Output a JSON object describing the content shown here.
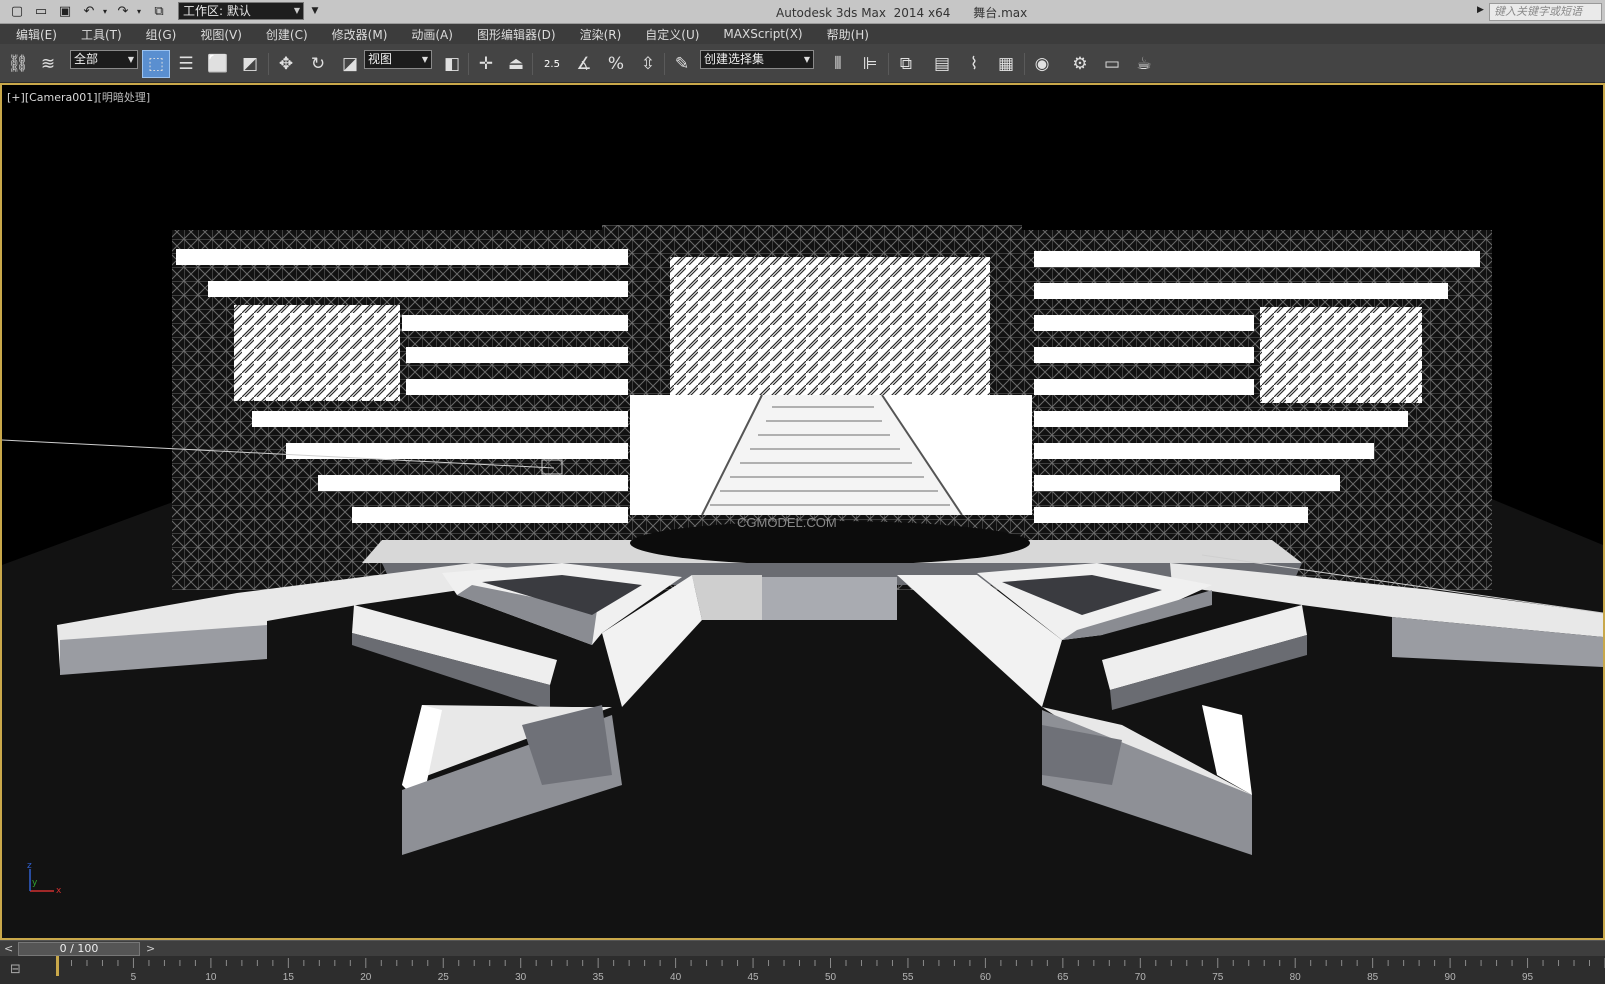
{
  "titlebar": {
    "app_title": "Autodesk 3ds Max  2014 x64",
    "file_name": "舞台.max",
    "workspace_label": "工作区: 默认",
    "search_placeholder": "键入关键字或短语",
    "quick_access": [
      "new-file-icon",
      "open-file-icon",
      "save-icon",
      "undo-icon",
      "redo-icon",
      "project-folder-icon"
    ]
  },
  "menubar": {
    "items": [
      "编辑(E)",
      "工具(T)",
      "组(G)",
      "视图(V)",
      "创建(C)",
      "修改器(M)",
      "动画(A)",
      "图形编辑器(D)",
      "渲染(R)",
      "自定义(U)",
      "MAXScript(X)",
      "帮助(H)"
    ]
  },
  "toolbar": {
    "selection_filter": "全部",
    "reference_coord": "视图",
    "named_selection": "创建选择集",
    "angle_snap_value": "2.5",
    "icons": [
      "link-icon",
      "unlink-icon",
      "select-object-icon",
      "select-by-name-icon",
      "rect-region-icon",
      "window-crossing-icon",
      "move-icon",
      "rotate-icon",
      "scale-icon",
      "pivot-center-icon",
      "manipulate-icon",
      "keyboard-shortcut-icon",
      "snap-toggle-icon",
      "angle-snap-icon",
      "percent-snap-icon",
      "spinner-snap-icon",
      "edit-named-sets-icon",
      "mirror-icon",
      "align-icon",
      "layer-manager-icon",
      "graphite-ribbon-icon",
      "curve-editor-icon",
      "schematic-view-icon",
      "material-editor-icon",
      "render-setup-icon",
      "rendered-frame-icon",
      "render-icon"
    ]
  },
  "viewport": {
    "label_plus": "[+]",
    "label_camera": "[Camera001]",
    "label_shading": "[明暗处理]",
    "watermark": "CGMODEL.COM"
  },
  "timeline": {
    "frame_display": "0 / 100",
    "prev": "<",
    "next": ">",
    "ticks": [
      "5",
      "10",
      "15",
      "20",
      "25",
      "30",
      "35",
      "40",
      "45",
      "50",
      "55",
      "60",
      "65",
      "70",
      "75",
      "80",
      "85",
      "90",
      "95"
    ]
  }
}
